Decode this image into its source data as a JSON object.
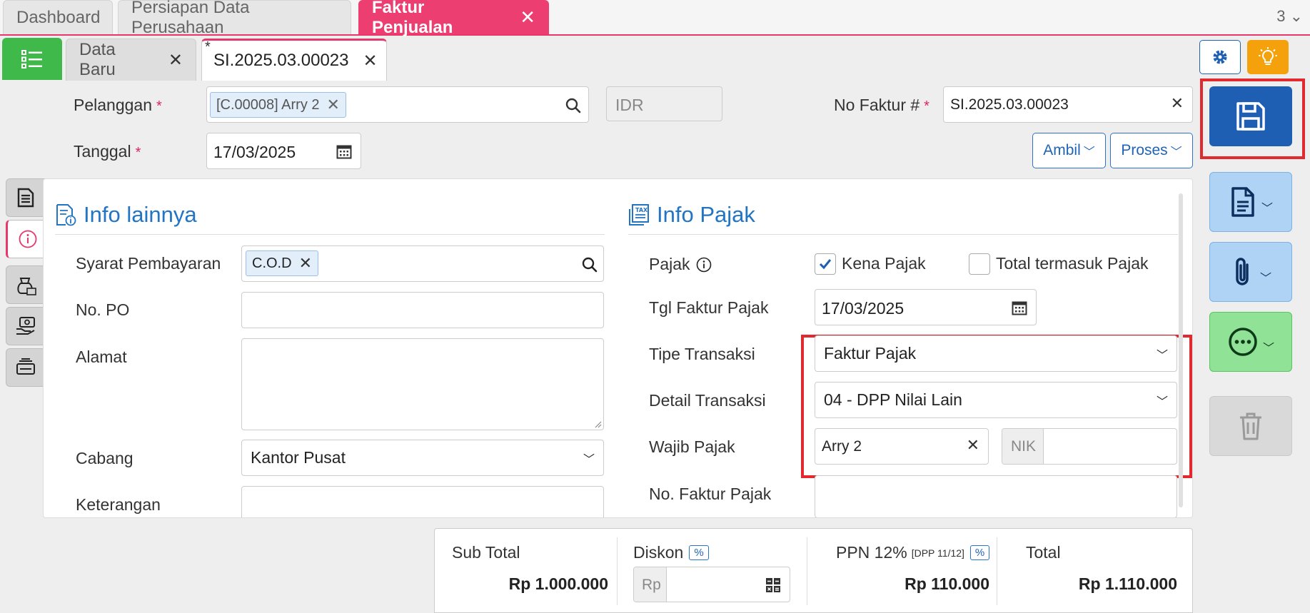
{
  "top_tabs": [
    {
      "label": "Dashboard"
    },
    {
      "label": "Persiapan Data Perusahaan"
    },
    {
      "label": "Faktur Penjualan"
    }
  ],
  "top_tab_count": "3",
  "sub_tabs": [
    {
      "label": "Data Baru"
    },
    {
      "label": "SI.2025.03.00023",
      "modified_mark": "*"
    }
  ],
  "header": {
    "customer_label": "Pelanggan",
    "customer_chip": "[C.00008] Arry 2",
    "currency": "IDR",
    "invoice_no_label": "No Faktur #",
    "invoice_no": "SI.2025.03.00023",
    "date_label": "Tanggal",
    "date_value": "17/03/2025",
    "take_button": "Ambil",
    "process_button": "Proses",
    "required_mark": "*"
  },
  "info_lainnya": {
    "title": "Info lainnya",
    "payment_terms_label": "Syarat Pembayaran",
    "payment_terms_chip": "C.O.D",
    "po_label": "No. PO",
    "po_value": "",
    "address_label": "Alamat",
    "address_value": "",
    "branch_label": "Cabang",
    "branch_value": "Kantor Pusat",
    "notes_label": "Keterangan"
  },
  "info_pajak": {
    "title": "Info Pajak",
    "tax_label": "Pajak",
    "taxable_label": "Kena Pajak",
    "taxable_checked": true,
    "tax_included_label": "Total termasuk Pajak",
    "tax_included_checked": false,
    "tax_invoice_date_label": "Tgl Faktur Pajak",
    "tax_invoice_date": "17/03/2025",
    "transaction_type_label": "Tipe Transaksi",
    "transaction_type": "Faktur Pajak",
    "transaction_detail_label": "Detail Transaksi",
    "transaction_detail": "04 - DPP Nilai Lain",
    "taxpayer_label": "Wajib Pajak",
    "taxpayer_value": "Arry 2",
    "nik_placeholder": "NIK",
    "tax_invoice_no_label": "No. Faktur Pajak",
    "tax_invoice_no": ""
  },
  "totals": {
    "subtotal_label": "Sub Total",
    "subtotal_value": "Rp 1.000.000",
    "discount_label": "Diskon",
    "discount_pct": "%",
    "discount_prefix": "Rp",
    "ppn_label": "PPN 12%",
    "ppn_note": "[DPP 11/12]",
    "ppn_pct": "%",
    "ppn_value": "Rp 110.000",
    "total_label": "Total",
    "total_value": "Rp 1.110.000"
  },
  "colors": {
    "accent_pink": "#ec3e71",
    "primary_blue": "#1e5fb4",
    "highlight_red": "#e02a2f",
    "green": "#3fb94a",
    "orange": "#f5a10b"
  }
}
